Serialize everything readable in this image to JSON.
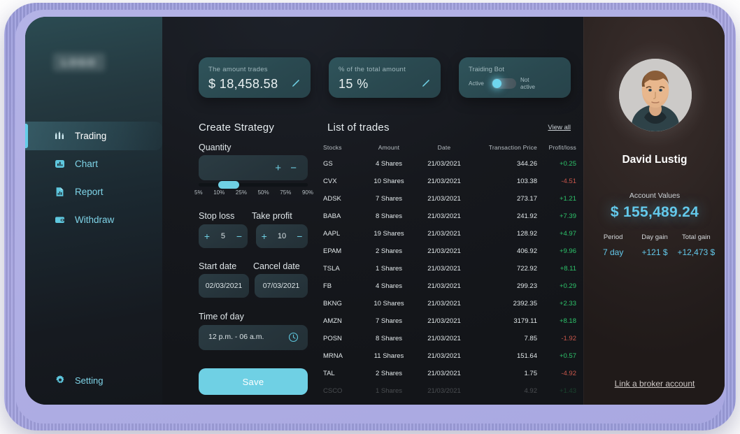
{
  "sidebar": {
    "logo": "LOGO",
    "items": [
      {
        "label": "Trading",
        "icon": "trading-icon",
        "active": true
      },
      {
        "label": "Chart",
        "icon": "chart-icon",
        "active": false
      },
      {
        "label": "Report",
        "icon": "report-icon",
        "active": false
      },
      {
        "label": "Withdraw",
        "icon": "withdraw-icon",
        "active": false
      }
    ],
    "setting": {
      "label": "Setting",
      "icon": "gear-icon"
    }
  },
  "cards": {
    "amount": {
      "label": "The amount trades",
      "value": "$ 18,458.58"
    },
    "percent": {
      "label": "% of the total amount",
      "value": "15 %"
    },
    "bot": {
      "label": "Traiding Bot",
      "active_label": "Active",
      "inactive_label": "Not active",
      "state": "active"
    }
  },
  "strategy": {
    "title": "Create Strategy",
    "quantity_label": "Quantity",
    "quantity_value": "",
    "slider_ticks": [
      "5%",
      "10%",
      "25%",
      "50%",
      "75%",
      "90%"
    ],
    "slider_position_pct": 18,
    "stop_loss_label": "Stop loss",
    "stop_loss_value": "5",
    "take_profit_label": "Take profit",
    "take_profit_value": "10",
    "start_date_label": "Start date",
    "start_date_value": "02/03/2021",
    "cancel_date_label": "Cancel date",
    "cancel_date_value": "07/03/2021",
    "time_of_day_label": "Time of day",
    "time_of_day_value": "12 p.m. - 06 a.m.",
    "save_label": "Save"
  },
  "trades": {
    "title": "List of trades",
    "view_all": "View all",
    "columns": [
      "Stocks",
      "Amount",
      "Date",
      "Transaction Price",
      "Profit/loss"
    ],
    "rows": [
      {
        "stock": "GS",
        "amount": "4 Shares",
        "date": "21/03/2021",
        "price": "344.26",
        "pl": "+0.25",
        "dir": "pos"
      },
      {
        "stock": "CVX",
        "amount": "10 Shares",
        "date": "21/03/2021",
        "price": "103.38",
        "pl": "-4.51",
        "dir": "neg"
      },
      {
        "stock": "ADSK",
        "amount": "7 Shares",
        "date": "21/03/2021",
        "price": "273.17",
        "pl": "+1.21",
        "dir": "pos"
      },
      {
        "stock": "BABA",
        "amount": "8 Shares",
        "date": "21/03/2021",
        "price": "241.92",
        "pl": "+7.39",
        "dir": "pos"
      },
      {
        "stock": "AAPL",
        "amount": "19 Shares",
        "date": "21/03/2021",
        "price": "128.92",
        "pl": "+4.97",
        "dir": "pos"
      },
      {
        "stock": "EPAM",
        "amount": "2 Shares",
        "date": "21/03/2021",
        "price": "406.92",
        "pl": "+9.96",
        "dir": "pos"
      },
      {
        "stock": "TSLA",
        "amount": "1 Shares",
        "date": "21/03/2021",
        "price": "722.92",
        "pl": "+8.11",
        "dir": "pos"
      },
      {
        "stock": "FB",
        "amount": "4 Shares",
        "date": "21/03/2021",
        "price": "299.23",
        "pl": "+0.29",
        "dir": "pos"
      },
      {
        "stock": "BKNG",
        "amount": "10 Shares",
        "date": "21/03/2021",
        "price": "2392.35",
        "pl": "+2.33",
        "dir": "pos"
      },
      {
        "stock": "AMZN",
        "amount": "7 Shares",
        "date": "21/03/2021",
        "price": "3179.11",
        "pl": "+8.18",
        "dir": "pos"
      },
      {
        "stock": "POSN",
        "amount": "8 Shares",
        "date": "21/03/2021",
        "price": "7.85",
        "pl": "-1.92",
        "dir": "neg"
      },
      {
        "stock": "MRNA",
        "amount": "11 Shares",
        "date": "21/03/2021",
        "price": "151.64",
        "pl": "+0.57",
        "dir": "pos"
      },
      {
        "stock": "TAL",
        "amount": "2 Shares",
        "date": "21/03/2021",
        "price": "1.75",
        "pl": "-4.92",
        "dir": "neg"
      },
      {
        "stock": "CSCO",
        "amount": "1 Shares",
        "date": "21/03/2021",
        "price": "4.92",
        "pl": "+1.43",
        "dir": "pos",
        "faded": true
      }
    ]
  },
  "profile": {
    "name": "David Lustig",
    "account_values_label": "Account Values",
    "account_value": "$ 155,489.24",
    "stats": [
      {
        "label": "Period",
        "value": "7 day"
      },
      {
        "label": "Day gain",
        "value": "+121 $"
      },
      {
        "label": "Total gain",
        "value": "+12,473 $"
      }
    ],
    "broker_link": "Link a broker account"
  },
  "colors": {
    "accent": "#6fd0e4",
    "accent_value": "#63c8ea",
    "positive": "#2ec46b",
    "negative": "#c9574b",
    "card_bg": "#2a4950",
    "bezel": "#a8a6e2"
  }
}
